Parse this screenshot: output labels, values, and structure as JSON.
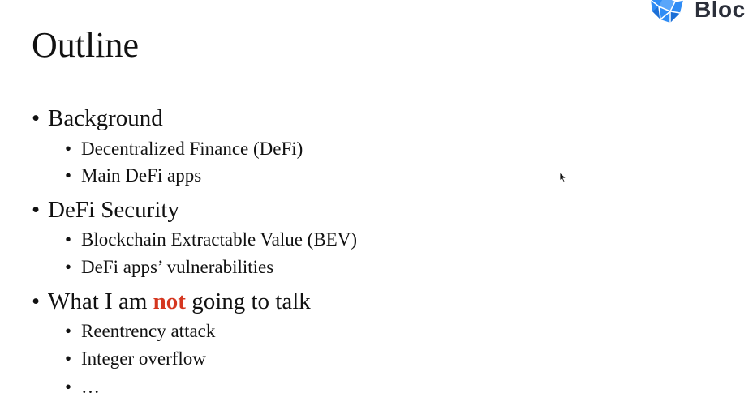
{
  "logo": {
    "text": "Bloc",
    "mark_icon": "polygon-logo-icon",
    "color": "#2f8cf5"
  },
  "title": "Outline",
  "bullet_char": "•",
  "sections": [
    {
      "label": "Background",
      "items": [
        "Decentralized Finance (DeFi)",
        "Main DeFi apps"
      ]
    },
    {
      "label": "DeFi Security",
      "items": [
        "Blockchain Extractable Value (BEV)",
        "DeFi apps’ vulnerabilities"
      ]
    },
    {
      "label_before": "What I am ",
      "label_emphasis": "not",
      "label_after": " going to talk",
      "items": [
        "Reentrency attack",
        "Integer overflow",
        "…"
      ]
    }
  ],
  "colors": {
    "emphasis": "#d5361f",
    "text": "#111111"
  },
  "cursor_icon": "mouse-pointer-icon"
}
